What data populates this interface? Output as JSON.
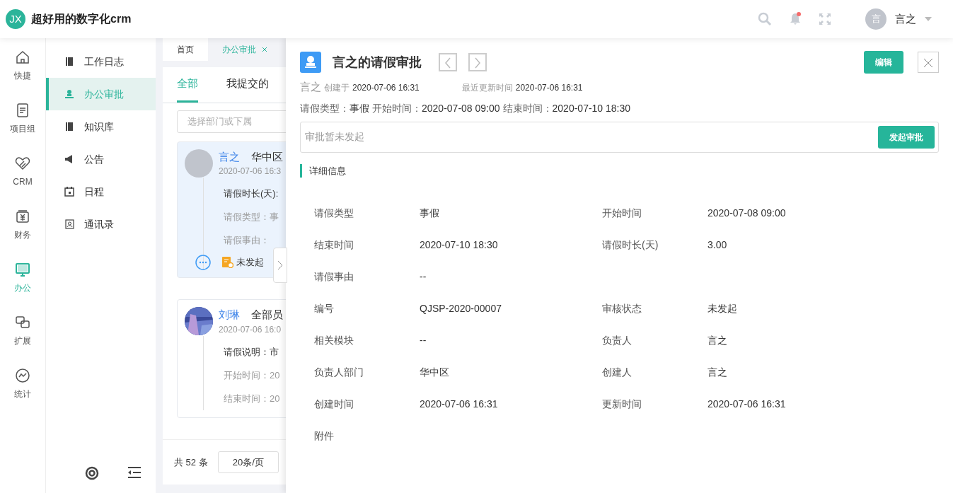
{
  "header": {
    "logo": "JX",
    "title": "超好用的数字化crm",
    "user_avatar": "言",
    "user_name": "言之",
    "notification_dot": true
  },
  "rail": [
    {
      "label": "快捷",
      "selected": false
    },
    {
      "label": "项目组",
      "selected": false
    },
    {
      "label": "CRM",
      "selected": false
    },
    {
      "label": "财务",
      "selected": false
    },
    {
      "label": "办公",
      "selected": true
    },
    {
      "label": "扩展",
      "selected": false
    },
    {
      "label": "统计",
      "selected": false
    }
  ],
  "submenu": [
    {
      "label": "工作日志",
      "selected": false
    },
    {
      "label": "办公审批",
      "selected": true
    },
    {
      "label": "知识库",
      "selected": false
    },
    {
      "label": "公告",
      "selected": false
    },
    {
      "label": "日程",
      "selected": false
    },
    {
      "label": "通讯录",
      "selected": false
    }
  ],
  "page_tabs": [
    {
      "label": "首页",
      "selected": false,
      "closable": false
    },
    {
      "label": "办公审批",
      "selected": true,
      "closable": true
    }
  ],
  "list": {
    "tabs": [
      {
        "label": "全部",
        "selected": true
      },
      {
        "label": "我提交的",
        "selected": false
      }
    ],
    "filter": {
      "placeholder": "选择部门或下属"
    },
    "cards": [
      {
        "name": "言之",
        "dept": "华中区",
        "time": "2020-07-06 16:3",
        "selected": true,
        "fields": [
          "请假时长(天):",
          "请假类型：事",
          "请假事由："
        ],
        "status": "未发起"
      },
      {
        "name": "刘琳",
        "dept": "全部员",
        "time": "2020-07-06 16:0",
        "kind": "picture",
        "selected": false,
        "fields": [
          "请假说明：市",
          "开始时间：20",
          "结束时间：20"
        ]
      }
    ],
    "total": "共 52 条",
    "page_size": "20条/页"
  },
  "detail": {
    "title": "言之的请假审批",
    "edit": "编辑",
    "creator": "言之",
    "created_label": "创建于",
    "created": "2020-07-06 16:31",
    "updated_label": "最近更新时间",
    "updated": "2020-07-06 16:31",
    "summary": [
      {
        "label": "请假类型：",
        "value": "事假"
      },
      {
        "label": "开始时间：",
        "value": "2020-07-08 09:00"
      },
      {
        "label": "结束时间：",
        "value": "2020-07-10 18:30"
      }
    ],
    "approval_text": "审批暂未发起",
    "approval_button": "发起审批",
    "section": "详细信息",
    "rows": [
      [
        {
          "label": "请假类型",
          "value": "事假"
        },
        {
          "label": "开始时间",
          "value": "2020-07-08 09:00"
        }
      ],
      [
        {
          "label": "结束时间",
          "value": "2020-07-10 18:30"
        },
        {
          "label": "请假时长(天)",
          "value": "3.00"
        }
      ],
      [
        {
          "label": "请假事由",
          "value": "--"
        }
      ],
      [
        {
          "label": "编号",
          "value": "QJSP-2020-00007"
        },
        {
          "label": "审核状态",
          "value": "未发起"
        }
      ],
      [
        {
          "label": "相关模块",
          "value": "--"
        },
        {
          "label": "负责人",
          "value": "言之"
        }
      ],
      [
        {
          "label": "负责人部门",
          "value": "华中区"
        },
        {
          "label": "创建人",
          "value": "言之"
        }
      ],
      [
        {
          "label": "创建时间",
          "value": "2020-07-06 16:31"
        },
        {
          "label": "更新时间",
          "value": "2020-07-06 16:31"
        }
      ],
      [
        {
          "label": "附件"
        }
      ]
    ]
  }
}
